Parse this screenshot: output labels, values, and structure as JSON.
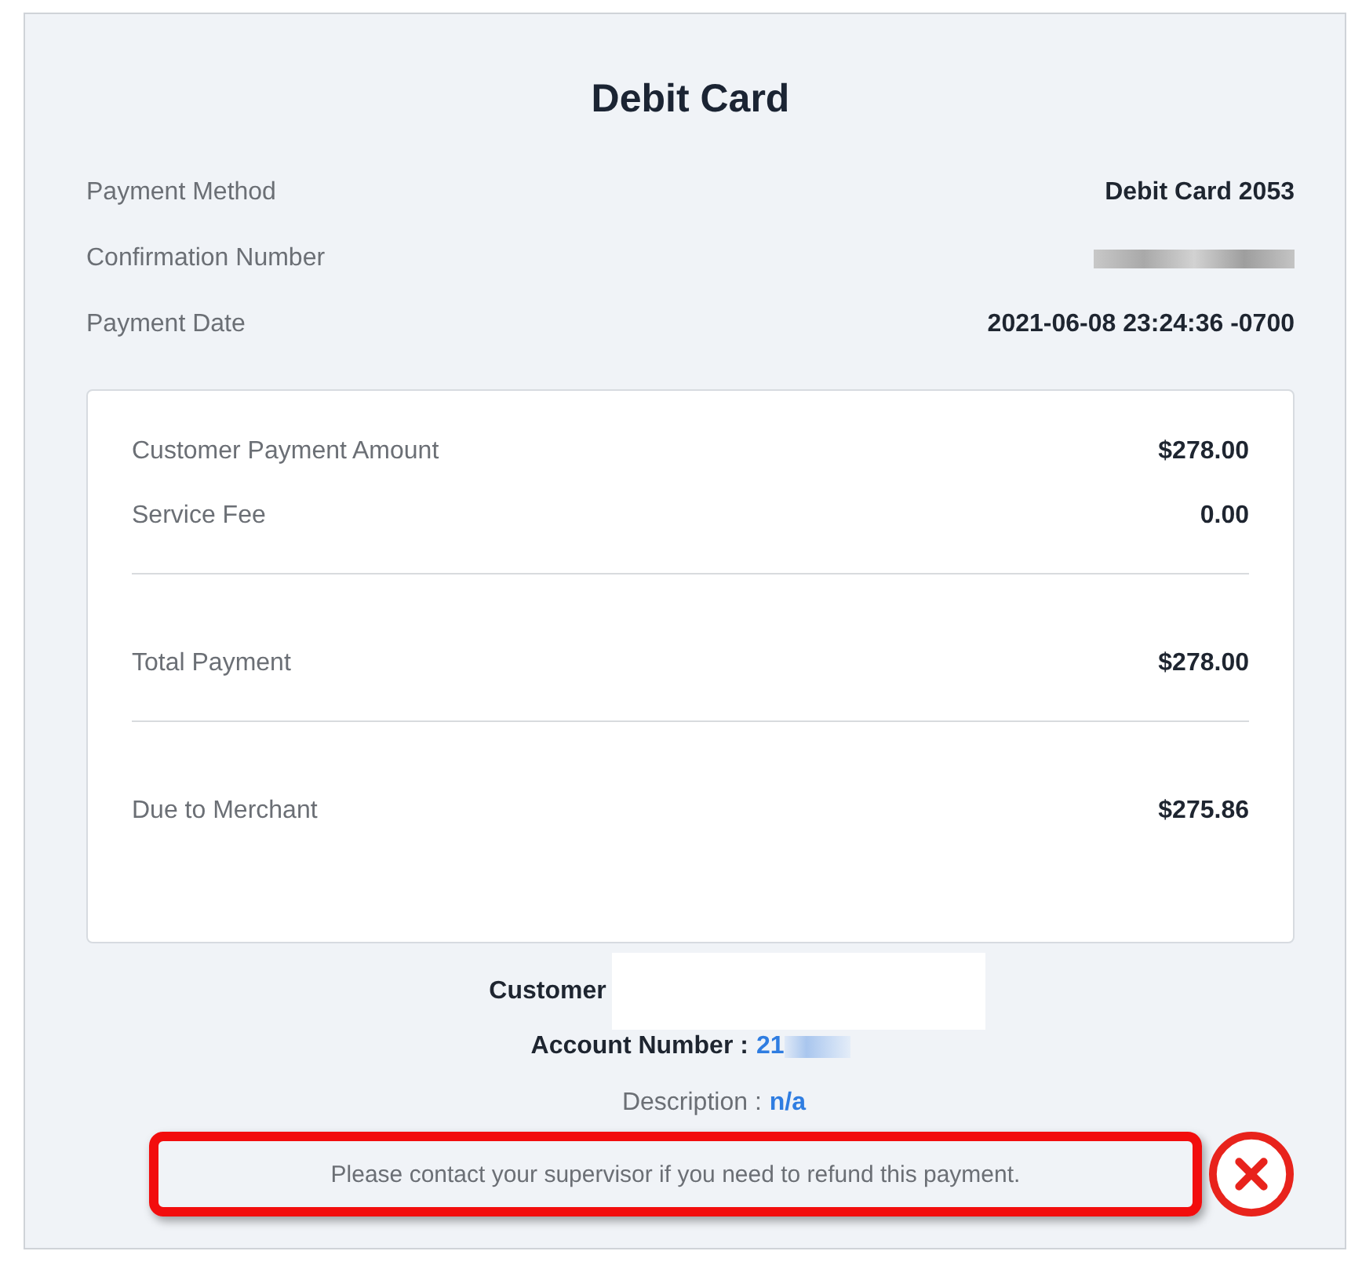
{
  "title": "Debit Card",
  "details": [
    {
      "label": "Payment Method",
      "value": "Debit Card 2053",
      "kind": "text"
    },
    {
      "label": "Confirmation Number",
      "kind": "redacted"
    },
    {
      "label": "Payment Date",
      "value": "2021-06-08 23:24:36 -0700",
      "kind": "text"
    }
  ],
  "summary_groups": [
    [
      {
        "label": "Customer Payment Amount",
        "value": "$278.00"
      },
      {
        "label": "Service Fee",
        "value": "0.00"
      }
    ],
    [
      {
        "label": "Total Payment",
        "value": "$278.00"
      }
    ],
    [
      {
        "label": "Due to Merchant",
        "value": "$275.86"
      }
    ]
  ],
  "customer": {
    "label": "Customer"
  },
  "account": {
    "label": "Account Number :",
    "value": "21"
  },
  "description": {
    "label": "Description :",
    "value": "n/a"
  },
  "notice": {
    "text": "Please contact your supervisor if you need to refund this payment.",
    "highlighted": true
  }
}
